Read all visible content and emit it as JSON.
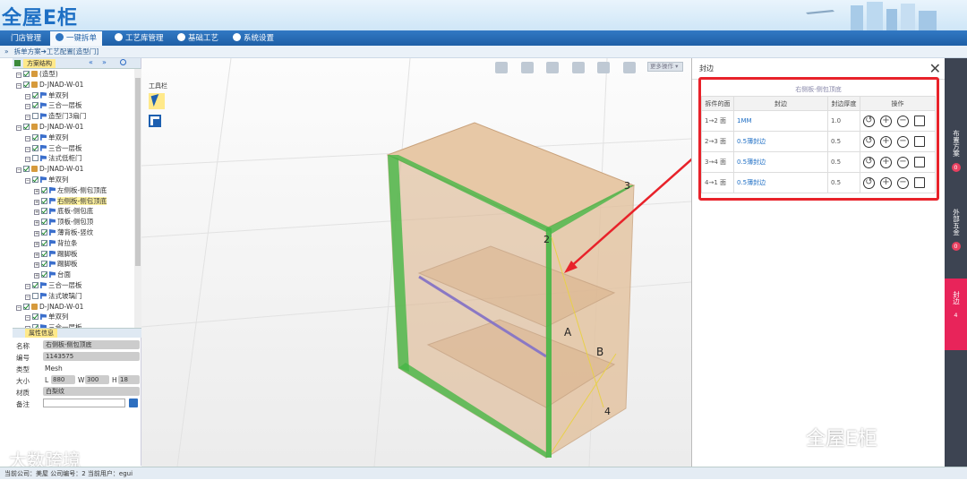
{
  "app": {
    "logo": "全屋E柜"
  },
  "nav": {
    "tabs": [
      {
        "label": "门店管理"
      },
      {
        "label": "一键拆单"
      },
      {
        "label": "工艺库管理"
      },
      {
        "label": "基础工艺"
      },
      {
        "label": "系统设置"
      }
    ],
    "active_index": 1
  },
  "breadcrumb": "拆单方案➔工艺配置[造型门]",
  "left": {
    "tree_header": "方案结构",
    "tree": [
      {
        "label": "(造型)",
        "level": 1,
        "checked": true,
        "kind": "root"
      },
      {
        "label": "D-JNAD-W-01",
        "level": 1,
        "checked": true,
        "kind": "box"
      },
      {
        "label": "单双列",
        "level": 2,
        "checked": true,
        "kind": "flag"
      },
      {
        "label": "三合一层板",
        "level": 2,
        "checked": true,
        "kind": "flag"
      },
      {
        "label": "造型门3扇门",
        "level": 2,
        "checked": false,
        "kind": "flag"
      },
      {
        "label": "D-JNAD-W-01",
        "level": 1,
        "checked": true,
        "kind": "box"
      },
      {
        "label": "单双列",
        "level": 2,
        "checked": true,
        "kind": "flag"
      },
      {
        "label": "三合一层板",
        "level": 2,
        "checked": true,
        "kind": "flag"
      },
      {
        "label": "法式低柜门",
        "level": 2,
        "checked": false,
        "kind": "flag"
      },
      {
        "label": "D-JNAD-W-01",
        "level": 1,
        "checked": true,
        "kind": "box"
      },
      {
        "label": "单双列",
        "level": 2,
        "checked": true,
        "kind": "flag"
      },
      {
        "label": "左侧板-侧包顶底",
        "level": 3,
        "checked": true,
        "kind": "flag"
      },
      {
        "label": "右侧板-侧包顶底",
        "level": 3,
        "checked": true,
        "kind": "flag",
        "selected": true
      },
      {
        "label": "底板-侧包底",
        "level": 3,
        "checked": true,
        "kind": "flag"
      },
      {
        "label": "顶板-侧包顶",
        "level": 3,
        "checked": true,
        "kind": "flag"
      },
      {
        "label": "薄背板-竖纹",
        "level": 3,
        "checked": true,
        "kind": "flag"
      },
      {
        "label": "背拉条",
        "level": 3,
        "checked": true,
        "kind": "flag"
      },
      {
        "label": "踢脚板",
        "level": 3,
        "checked": true,
        "kind": "flag"
      },
      {
        "label": "踢脚板",
        "level": 3,
        "checked": true,
        "kind": "flag"
      },
      {
        "label": "台面",
        "level": 3,
        "checked": true,
        "kind": "flag"
      },
      {
        "label": "三合一层板",
        "level": 2,
        "checked": true,
        "kind": "flag"
      },
      {
        "label": "法式玻璃门",
        "level": 2,
        "checked": false,
        "kind": "flag"
      },
      {
        "label": "D-JNAD-W-01",
        "level": 1,
        "checked": true,
        "kind": "box"
      },
      {
        "label": "单双列",
        "level": 2,
        "checked": true,
        "kind": "flag"
      },
      {
        "label": "三合一层板",
        "level": 2,
        "checked": true,
        "kind": "flag"
      }
    ],
    "props_header": "属性信息",
    "props": {
      "name_label": "名称",
      "name": "右侧板-侧包顶底",
      "code_label": "编号",
      "code": "1143575",
      "type_label": "类型",
      "type": "Mesh",
      "size_label": "大小",
      "L_label": "L",
      "L": "880",
      "W_label": "W",
      "W": "300",
      "H_label": "H",
      "H": "18",
      "material_label": "材质",
      "material": "白梨纹",
      "note_label": "备注",
      "note": ""
    }
  },
  "viewport": {
    "toolbox_label": "工具栏",
    "more_label": "更多操作",
    "points": [
      "2",
      "3",
      "4"
    ],
    "faces": [
      "A",
      "B"
    ]
  },
  "dialog": {
    "title": "封边",
    "subtitle": "右侧板-侧包顶底",
    "columns": [
      "拆件的面",
      "封边",
      "封边厚度",
      "操作"
    ],
    "rows": [
      {
        "face": "1→2 面",
        "edge": "1MM",
        "thickness": "1.0"
      },
      {
        "face": "2→3 面",
        "edge": "0.5薄封边",
        "thickness": "0.5"
      },
      {
        "face": "3→4 面",
        "edge": "0.5薄封边",
        "thickness": "0.5"
      },
      {
        "face": "4→1 面",
        "edge": "0.5薄封边",
        "thickness": "0.5"
      }
    ]
  },
  "side_tabs": [
    {
      "label": "布置方案",
      "count": "0"
    },
    {
      "label": "外部五金",
      "count": "0"
    },
    {
      "label": "封边",
      "count": "4",
      "active": true
    }
  ],
  "status": "当前公司：美屋  公司编号：2  当前用户：egui",
  "watermarks": {
    "left": "大数跨境",
    "right": "全屋E柜"
  },
  "colors": {
    "highlight": "#e8222a",
    "accent": "#1e5fa6",
    "active_tab": "#e8245a"
  }
}
